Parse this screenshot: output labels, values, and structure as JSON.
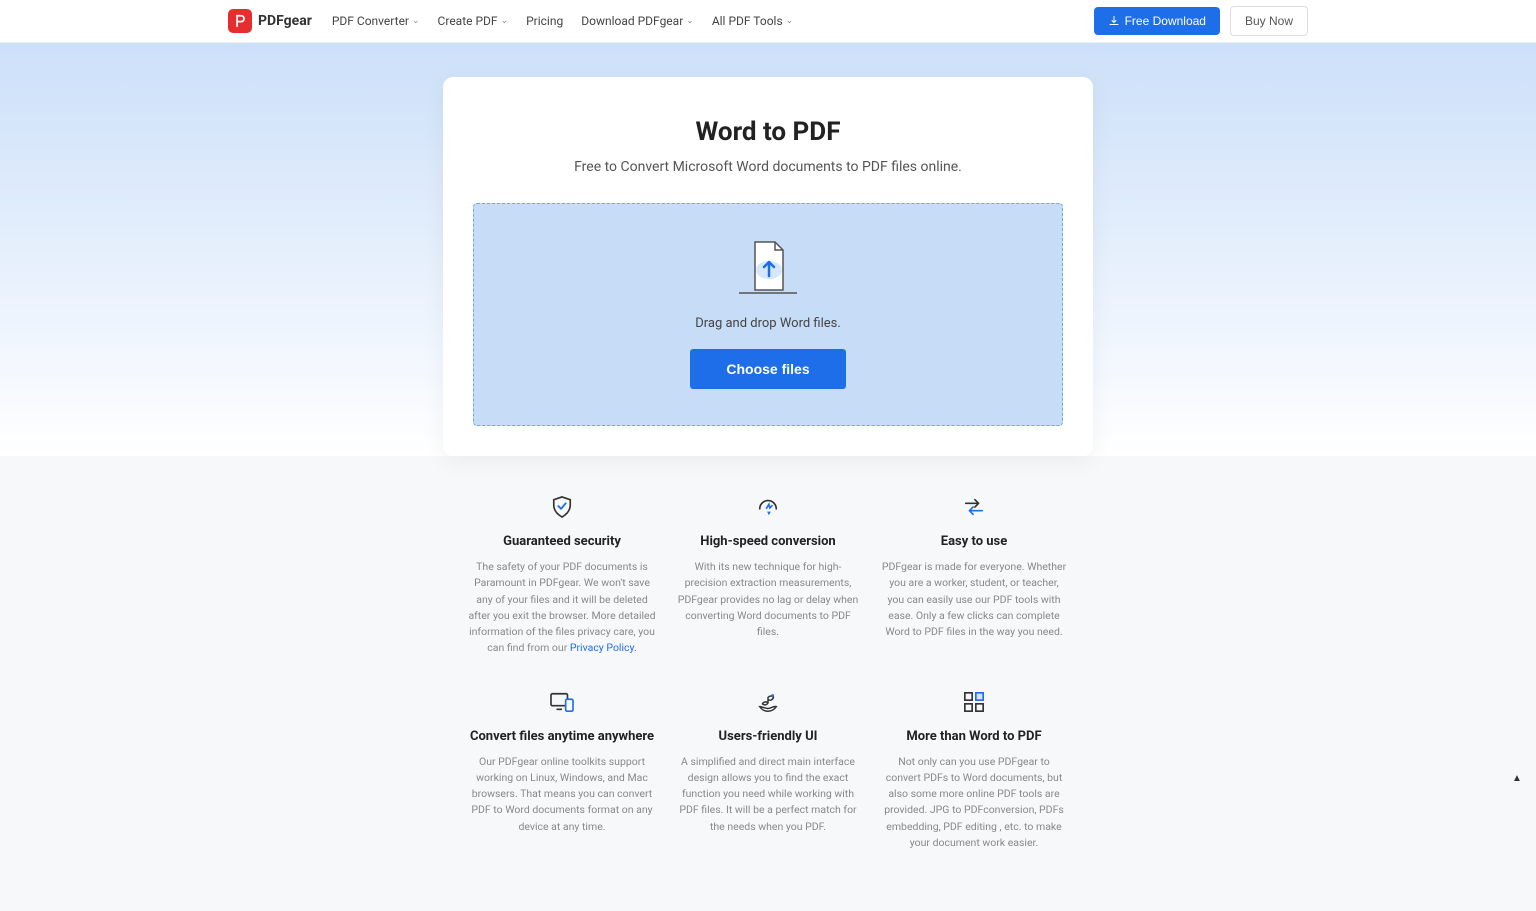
{
  "header": {
    "brand": "PDFgear",
    "nav": [
      {
        "label": "PDF Converter",
        "dropdown": true
      },
      {
        "label": "Create PDF",
        "dropdown": true
      },
      {
        "label": "Pricing",
        "dropdown": false
      },
      {
        "label": "Download PDFgear",
        "dropdown": true
      },
      {
        "label": "All PDF Tools",
        "dropdown": true
      }
    ],
    "free_download": "Free Download",
    "buy_now": "Buy Now"
  },
  "hero": {
    "title": "Word to PDF",
    "subtitle": "Free to Convert Microsoft Word documents to PDF files online.",
    "drop_text": "Drag and drop Word files.",
    "choose_label": "Choose files"
  },
  "features": [
    {
      "title": "Guaranteed security",
      "desc": "The safety of your PDF documents is Paramount in PDFgear. We won't save any of your files and it will be deleted after you exit the browser. More detailed information of the files privacy care, you can find from our ",
      "link": "Privacy Policy."
    },
    {
      "title": "High-speed conversion",
      "desc": "With its new technique for high-precision extraction measurements, PDFgear provides no lag or delay when converting Word documents to PDF files."
    },
    {
      "title": "Easy to use",
      "desc": "PDFgear is made for everyone. Whether you are a worker, student, or teacher, you can easily use our PDF tools with ease. Only a few clicks can complete Word to PDF files in the way you need."
    },
    {
      "title": "Convert files anytime anywhere",
      "desc": "Our PDFgear online toolkits support working on Linux, Windows, and Mac browsers. That means you can convert PDF to Word documents format on any device at any time."
    },
    {
      "title": "Users-friendly UI",
      "desc": "A simplified and direct main interface design allows you to find the exact function you need while working with PDF files. It will be a perfect match for the needs when you PDF."
    },
    {
      "title": "More than Word to PDF",
      "desc": "Not only can you use PDFgear to convert PDFs to Word documents, but also some more online PDF tools are provided. JPG to PDFconversion, PDFs embedding, PDF editing , etc. to make your document work easier."
    }
  ]
}
